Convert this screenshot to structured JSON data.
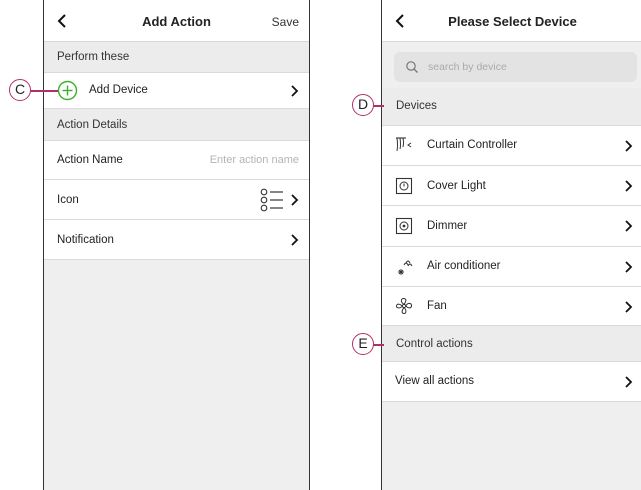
{
  "left_screen": {
    "title": "Add Action",
    "save_label": "Save",
    "section_perform": "Perform these",
    "add_device_label": "Add Device",
    "section_action_details": "Action Details",
    "action_name_label": "Action Name",
    "action_name_placeholder": "Enter action name",
    "icon_label": "Icon",
    "notification_label": "Notification"
  },
  "right_screen": {
    "title": "Please Select Device",
    "search_placeholder": "search by device",
    "section_devices": "Devices",
    "devices": [
      {
        "label": "Curtain Controller",
        "icon": "curtain-icon"
      },
      {
        "label": "Cover Light",
        "icon": "cover-light-icon"
      },
      {
        "label": "Dimmer",
        "icon": "dimmer-icon"
      },
      {
        "label": "Air conditioner",
        "icon": "air-conditioner-icon"
      },
      {
        "label": "Fan",
        "icon": "fan-icon"
      }
    ],
    "section_control": "Control actions",
    "view_all_label": "View all actions"
  },
  "callouts": {
    "c": "C",
    "d": "D",
    "e": "E"
  },
  "colors": {
    "callout": "#b0306a",
    "add_icon": "#3dae2b"
  }
}
